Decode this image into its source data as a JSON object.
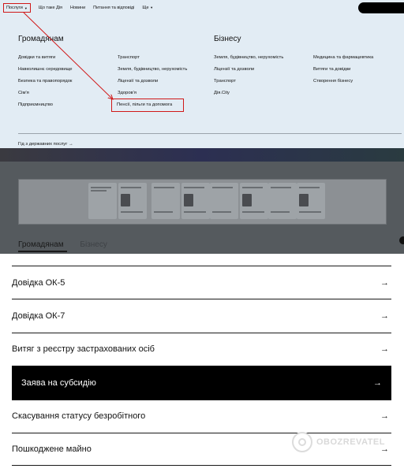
{
  "nav": {
    "items": [
      "Послуги",
      "Що таке Дія",
      "Новини",
      "Питання та відповіді",
      "Ще"
    ]
  },
  "menu": {
    "citizens": {
      "title": "Громадянам",
      "col1": [
        "Довідки та витяги",
        "Навколишнє середовище",
        "Безпека та правопорядок",
        "Сім'я",
        "Підприємництво"
      ],
      "col2": [
        "Транспорт",
        "Земля, будівництво, нерухомість",
        "Ліцензії та дозволи",
        "Здоров'я",
        "Пенсії, пільги та допомога"
      ]
    },
    "business": {
      "title": "Бізнесу",
      "col1": [
        "Земля, будівництво, нерухомість",
        "Ліцензії та дозволи",
        "Транспорт",
        "Дія.City"
      ],
      "col2": [
        "Медицина та фармацевтика",
        "Витяги та довідки",
        "Створення бізнесу"
      ]
    },
    "all_services": "Гід з державних послуг"
  },
  "page_tabs": [
    "Громадянам",
    "Бізнесу"
  ],
  "services": [
    "Довідка ОК-5",
    "Довідка ОК-7",
    "Витяг з реєстру застрахованих осіб",
    "Заява на субсидію",
    "Скасування статусу безробітного",
    "Пошкоджене майно"
  ],
  "active_service_index": 3,
  "watermark": "OBOZREVATEL",
  "colors": {
    "highlight": "#d01818",
    "menu_bg": "#e2ecf4",
    "active_row": "#000000"
  }
}
